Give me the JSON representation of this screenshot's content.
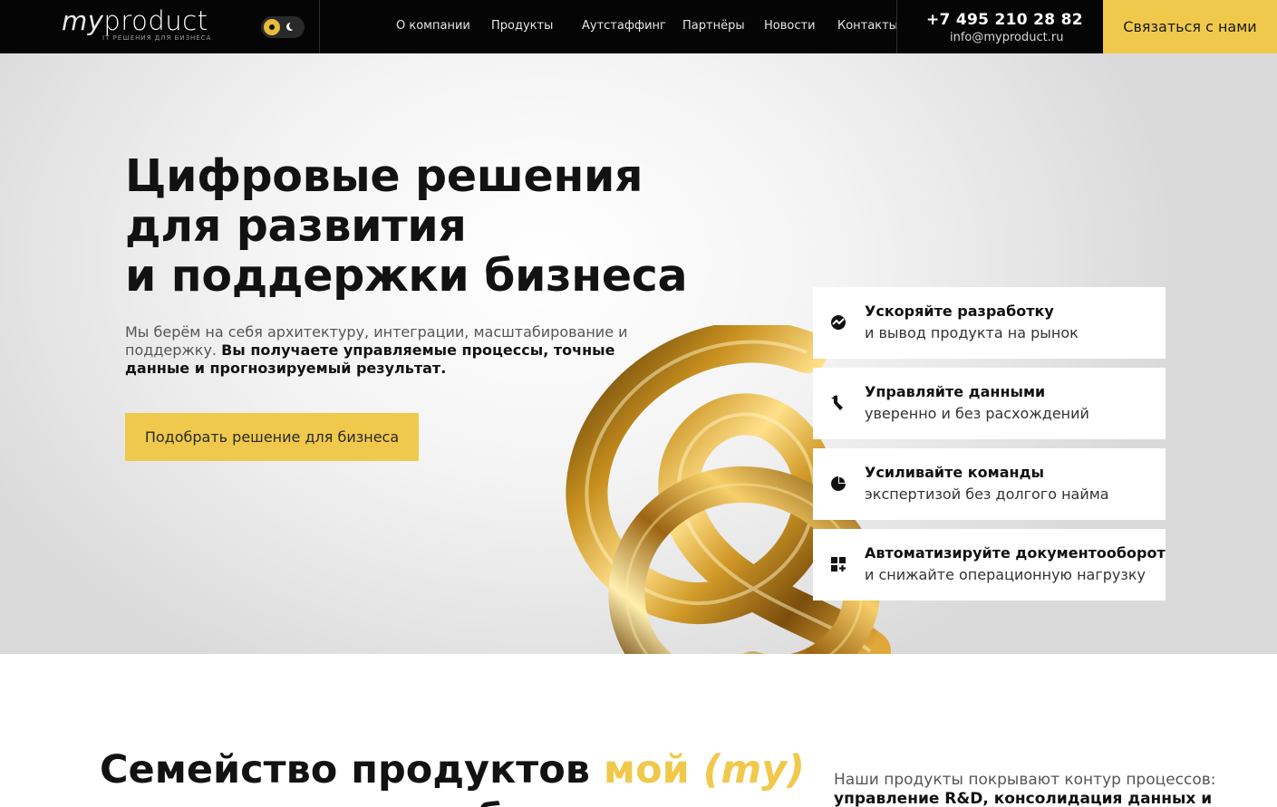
{
  "header": {
    "logo_my": "my",
    "logo_product": "product",
    "logo_tagline": "IT РЕШЕНИЯ ДЛЯ БИЗНЕСА",
    "nav": [
      "О компании",
      "Продукты",
      "Аутстаффинг",
      "Партнёры",
      "Новости",
      "Контакты"
    ],
    "phone": "+7 495 210 28 82",
    "email": "info@myproduct.ru",
    "contact_button": "Связаться с нами"
  },
  "hero": {
    "title_lines": [
      "Цифровые решения",
      "для развития",
      "и поддержки бизнеса"
    ],
    "description_regular": "Мы берём на себя архитектуру, интеграции, масштабирование и поддержку.",
    "description_bold": "Вы получаете управляемые процессы, точные данные и прогнозируемый результат.",
    "cta_button": "Подобрать решение для бизнеса"
  },
  "features": [
    {
      "icon": "chart-circle-icon",
      "title": "Ускоряйте разработку",
      "subtitle": "и вывод продукта на рынок"
    },
    {
      "icon": "refresh-arrows-icon",
      "title": "Управляйте данными",
      "subtitle": "уверенно и без расхождений"
    },
    {
      "icon": "pie-chart-icon",
      "title": "Усиливайте команды",
      "subtitle": "экспертизой без долгого найма"
    },
    {
      "icon": "grid-plus-icon",
      "title": "Автоматизируйте документооборот",
      "subtitle": "и снижайте операционную нагрузку"
    }
  ],
  "products": {
    "title_start": "Семейство продуктов ",
    "title_gold": "мой ",
    "title_gold_italic": "(my)",
    "title_line2": "для управления бизнесом",
    "description_regular": "Наши продукты покрывают контур процессов:",
    "description_bold": "управление R&D, консолидация данных и"
  },
  "colors": {
    "accent": "#f0c94c",
    "header_bg": "#050505",
    "text_dark": "#121212"
  }
}
